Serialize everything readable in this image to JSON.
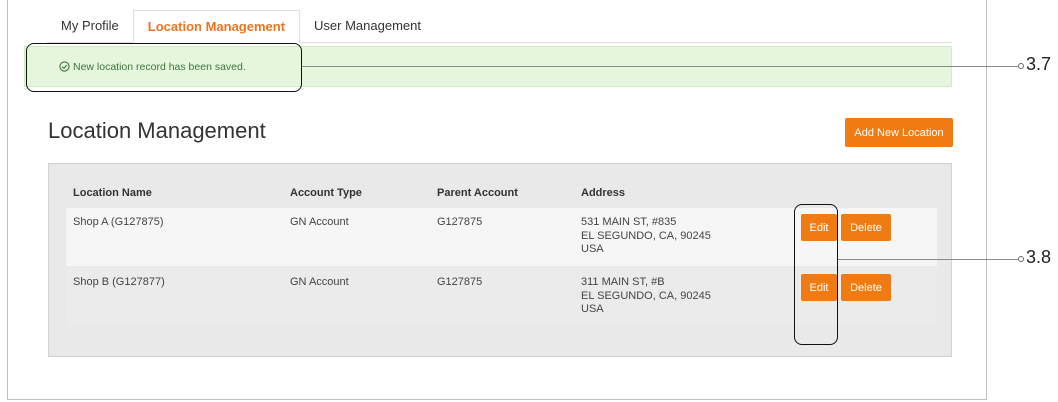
{
  "tabs": [
    {
      "label": "My Profile",
      "active": false
    },
    {
      "label": "Location Management",
      "active": true
    },
    {
      "label": "User Management",
      "active": false
    }
  ],
  "alert": {
    "message": "New location record has been saved.",
    "icon": "check-circle-icon",
    "color": "#3c763d"
  },
  "page": {
    "title": "Location Management",
    "add_button": "Add New Location"
  },
  "table": {
    "columns": [
      "Location Name",
      "Account Type",
      "Parent Account",
      "Address"
    ],
    "rows": [
      {
        "name": "Shop A (G127875)",
        "account_type": "GN Account",
        "parent": "G127875",
        "address": [
          "531 MAIN ST, #835",
          "EL SEGUNDO, CA, 90245",
          "USA"
        ],
        "edit": "Edit",
        "delete": "Delete"
      },
      {
        "name": "Shop B (G127877)",
        "account_type": "GN Account",
        "parent": "G127875",
        "address": [
          "311 MAIN ST, #B",
          "EL SEGUNDO, CA, 90245",
          "USA"
        ],
        "edit": "Edit",
        "delete": "Delete"
      }
    ]
  },
  "callouts": {
    "alert": "3.7",
    "edit": "3.8"
  },
  "colors": {
    "accent": "#f07b12",
    "tab_active": "#ea7420",
    "alert_bg": "#e6f6dd"
  }
}
